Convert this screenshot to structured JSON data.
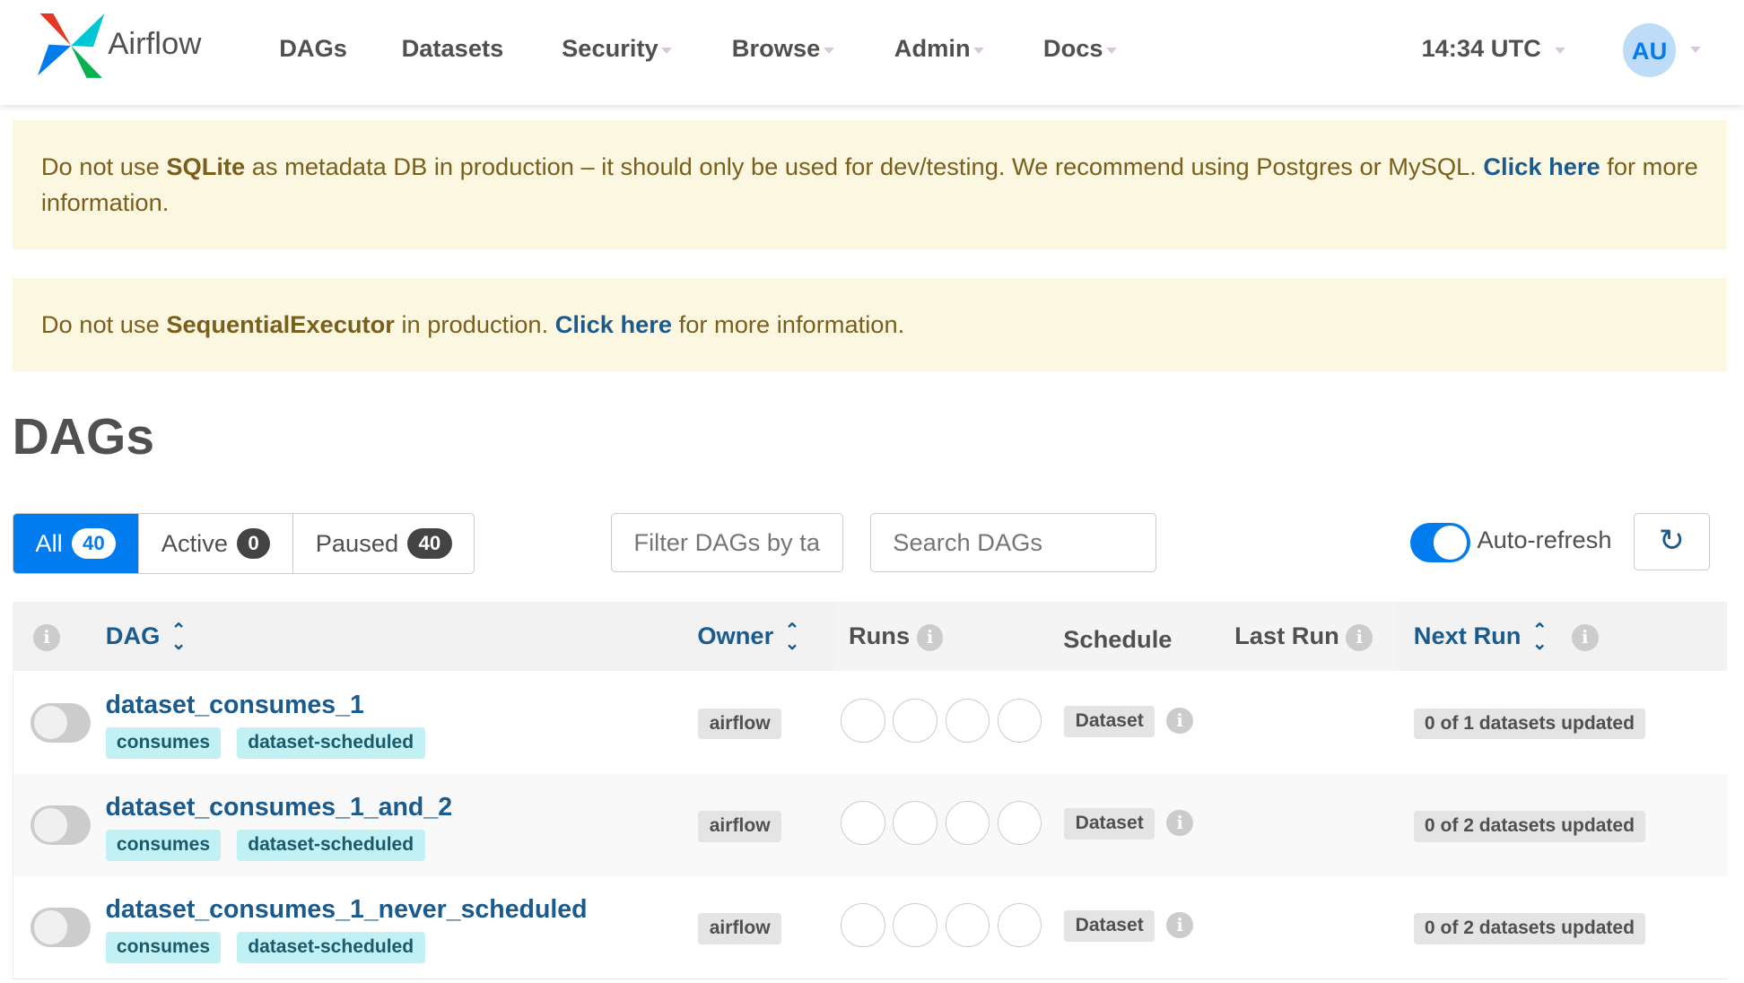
{
  "nav": {
    "brand": "Airflow",
    "items": [
      {
        "label": "DAGs",
        "dropdown": false
      },
      {
        "label": "Datasets",
        "dropdown": false
      },
      {
        "label": "Security",
        "dropdown": true
      },
      {
        "label": "Browse",
        "dropdown": true
      },
      {
        "label": "Admin",
        "dropdown": true
      },
      {
        "label": "Docs",
        "dropdown": true
      }
    ],
    "time": "14:34 UTC",
    "user_initials": "AU"
  },
  "banners": [
    {
      "pre": "Do not use ",
      "bold": "SQLite",
      "mid": " as metadata DB in production – it should only be used for dev/testing. We recommend using Postgres or MySQL. ",
      "link": "Click here",
      "post": " for more information."
    },
    {
      "pre": "Do not use ",
      "bold": "SequentialExecutor",
      "mid": " in production. ",
      "link": "Click here",
      "post": " for more information."
    }
  ],
  "page_title": "DAGs",
  "filters": {
    "all": "All",
    "all_count": "40",
    "active": "Active",
    "active_count": "0",
    "paused": "Paused",
    "paused_count": "40",
    "tags_placeholder": "Filter DAGs by tag",
    "search_placeholder": "Search DAGs",
    "auto_refresh": "Auto-refresh",
    "auto_refresh_on": true
  },
  "columns": {
    "dag": "DAG",
    "owner": "Owner",
    "runs": "Runs",
    "schedule": "Schedule",
    "last_run": "Last Run",
    "next_run": "Next Run"
  },
  "rows": [
    {
      "name": "dataset_consumes_1",
      "tags": [
        "consumes",
        "dataset-scheduled"
      ],
      "owner": "airflow",
      "schedule": "Dataset",
      "next_run": "0 of 1 datasets updated",
      "paused": true
    },
    {
      "name": "dataset_consumes_1_and_2",
      "tags": [
        "consumes",
        "dataset-scheduled"
      ],
      "owner": "airflow",
      "schedule": "Dataset",
      "next_run": "0 of 2 datasets updated",
      "paused": true
    },
    {
      "name": "dataset_consumes_1_never_scheduled",
      "tags": [
        "consumes",
        "dataset-scheduled"
      ],
      "owner": "airflow",
      "schedule": "Dataset",
      "next_run": "0 of 2 datasets updated",
      "paused": true
    }
  ],
  "colors": {
    "accent": "#017cee",
    "link": "#1a5a8c",
    "banner_bg": "#fbf7e0",
    "tag_bg": "#c2f1f5"
  }
}
